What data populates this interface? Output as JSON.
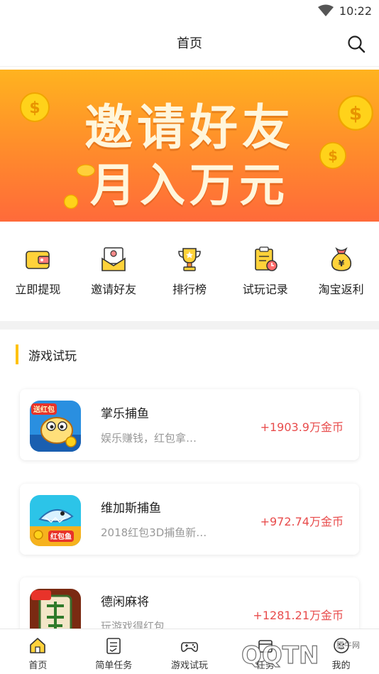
{
  "status_bar": {
    "time": "10:22"
  },
  "header": {
    "title": "首页"
  },
  "banner": {
    "line1": "邀请好友",
    "line2": "月入万元"
  },
  "quick_actions": [
    {
      "label": "立即提现",
      "icon": "wallet-icon"
    },
    {
      "label": "邀请好友",
      "icon": "invite-envelope-icon"
    },
    {
      "label": "排行榜",
      "icon": "trophy-icon"
    },
    {
      "label": "试玩记录",
      "icon": "record-clipboard-icon"
    },
    {
      "label": "淘宝返利",
      "icon": "money-bag-icon"
    }
  ],
  "section": {
    "title": "游戏试玩"
  },
  "games": [
    {
      "name": "掌乐捕鱼",
      "desc": "娱乐赚钱，红包拿…",
      "reward": "+1903.9万金币",
      "icon_badge": "送红包"
    },
    {
      "name": "维加斯捕鱼",
      "desc": "2018红包3D捕鱼新…",
      "reward": "+972.74万金币",
      "icon_badge": "红包鱼"
    },
    {
      "name": "德闲麻将",
      "desc": "玩游戏得红包",
      "reward": "+1281.21万金币",
      "icon_badge": ""
    }
  ],
  "tabs": [
    {
      "label": "首页",
      "icon": "home-icon",
      "active": true
    },
    {
      "label": "简单任务",
      "icon": "task-icon",
      "active": false
    },
    {
      "label": "游戏试玩",
      "icon": "gamepad-icon",
      "active": false
    },
    {
      "label": "任务",
      "icon": "box-icon",
      "active": false
    },
    {
      "label": "我的",
      "icon": "profile-icon",
      "active": false
    }
  ],
  "watermark": {
    "text": "QQTN",
    "subtext": "腾牛网"
  },
  "colors": {
    "accent": "#ffc20e",
    "reward": "#e84c4c",
    "banner_top": "#ffb31f",
    "banner_bottom": "#ff6a3a"
  }
}
